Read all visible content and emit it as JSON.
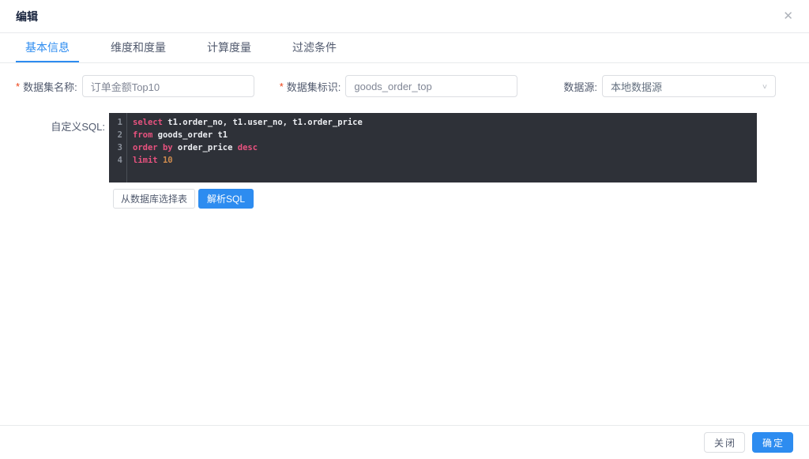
{
  "dialog": {
    "title": "编辑"
  },
  "icons": {
    "close": "✕",
    "chevron_down": "∨"
  },
  "tabs": [
    {
      "label": "基本信息",
      "active": true
    },
    {
      "label": "维度和度量",
      "active": false
    },
    {
      "label": "计算度量",
      "active": false
    },
    {
      "label": "过滤条件",
      "active": false
    }
  ],
  "form": {
    "required_mark": "*",
    "dataset_name": {
      "label": "数据集名称:",
      "required": true,
      "value": "订单金额Top10"
    },
    "dataset_code": {
      "label": "数据集标识:",
      "required": true,
      "value": "goods_order_top"
    },
    "datasource": {
      "label": "数据源:",
      "value": "本地数据源"
    }
  },
  "sql": {
    "label": "自定义SQL:",
    "lines": [
      [
        [
          "kw",
          "select"
        ],
        [
          "id",
          " t1.order_no, t1.user_no, t1.order_price"
        ]
      ],
      [
        [
          "kw",
          "from"
        ],
        [
          "id",
          " goods_order t1"
        ]
      ],
      [
        [
          "kw",
          "order"
        ],
        [
          "id",
          " "
        ],
        [
          "kw",
          "by"
        ],
        [
          "id",
          " order_price "
        ],
        [
          "kw",
          "desc"
        ]
      ],
      [
        [
          "kw",
          "limit"
        ],
        [
          "id",
          " "
        ],
        [
          "num",
          "10"
        ]
      ]
    ],
    "buttons": {
      "select_table": "从数据库选择表",
      "parse_sql": "解析SQL"
    }
  },
  "footer": {
    "close": "关闭",
    "confirm": "确定"
  },
  "colors": {
    "primary": "#2d8cf0",
    "required": "#ed4014",
    "editor_bg": "#2e3138",
    "editor_divider": "#4a4e56",
    "gutter_text": "#8b919b",
    "code_text": "#eceef2",
    "code_kw": "#e8527f",
    "code_num": "#cf8b4e"
  }
}
